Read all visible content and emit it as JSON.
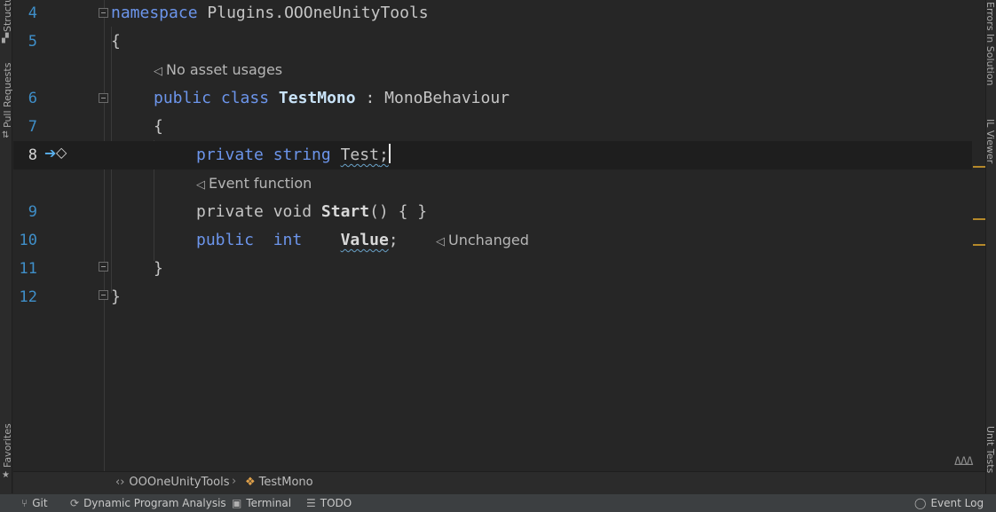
{
  "left_strip": {
    "tabs": [
      {
        "label": "Structure",
        "icon": "structure-icon"
      },
      {
        "label": "Pull Requests",
        "icon": "pull-request-icon"
      },
      {
        "label": "Favorites",
        "icon": "star-icon"
      }
    ]
  },
  "right_strip": {
    "tabs": [
      {
        "label": "Errors In Solution",
        "icon": "errors-icon"
      },
      {
        "label": "IL Viewer",
        "icon": "il-viewer-icon"
      },
      {
        "label": "Unit Tests",
        "icon": "unit-tests-icon"
      }
    ]
  },
  "editor": {
    "line_numbers": [
      "4",
      "5",
      "6",
      "7",
      "8",
      "9",
      "10",
      "11",
      "12"
    ],
    "code": {
      "l4_kw": "namespace",
      "l4_name": "Plugins.OOOneUnityTools",
      "brace_open": "{",
      "brace_close": "}",
      "l6_kw1": "public",
      "l6_kw2": "class",
      "l6_cls": "TestMono",
      "l6_colon": ":",
      "l6_base": "MonoBehaviour",
      "l8_kw1": "private",
      "l8_kw2": "string",
      "l8_name": "Test",
      "l8_semi": ";",
      "l9_kw1": "private",
      "l9_kw2": "void",
      "l9_fn": "Start",
      "l9_rest": "() { }",
      "l10_kw1": "public",
      "l10_kw2": "int",
      "l10_name": "Value",
      "l10_semi": ";"
    },
    "hints": {
      "no_asset_usages": "No asset usages",
      "event_function": "Event function",
      "unchanged": "Unchanged"
    },
    "gutter_icons": [
      "run-arrow-icon",
      "unity-event-icon"
    ],
    "inspection_widget": "ΔΔΔ"
  },
  "breadcrumb": {
    "namespace": "OOOneUnityTools",
    "separator": "›",
    "class": "TestMono"
  },
  "statusbar": {
    "git": "Git",
    "dpa": "Dynamic Program Analysis",
    "terminal": "Terminal",
    "todo": "TODO",
    "event_log": "Event Log"
  },
  "colors": {
    "keyword": "#6c95eb",
    "line_number": "#3f8fc9",
    "marker": "#b5892a",
    "background": "#262626"
  }
}
